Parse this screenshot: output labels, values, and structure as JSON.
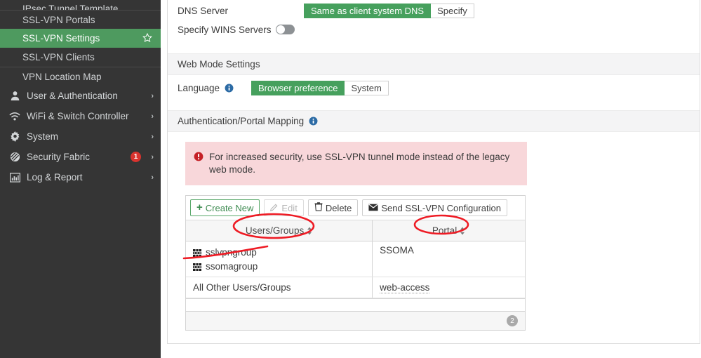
{
  "sidebar": {
    "items": [
      {
        "label": "IPsec Tunnel Template",
        "type": "sub",
        "partial": true
      },
      {
        "label": "SSL-VPN Portals",
        "type": "sub"
      },
      {
        "label": "SSL-VPN Settings",
        "type": "sub",
        "active": true,
        "star": "★"
      },
      {
        "label": "SSL-VPN Clients",
        "type": "sub"
      },
      {
        "label": "VPN Location Map",
        "type": "sub"
      },
      {
        "label": "User & Authentication",
        "type": "top",
        "icon": "user-icon",
        "chevron": "›"
      },
      {
        "label": "WiFi & Switch Controller",
        "type": "top",
        "icon": "wifi-icon",
        "chevron": "›"
      },
      {
        "label": "System",
        "type": "top",
        "icon": "gear-icon",
        "chevron": "›"
      },
      {
        "label": "Security Fabric",
        "type": "top",
        "icon": "fabric-icon",
        "chevron": "›",
        "badge": "1"
      },
      {
        "label": "Log & Report",
        "type": "top",
        "icon": "chart-icon",
        "chevron": "›"
      }
    ]
  },
  "main": {
    "dns_server": {
      "label": "DNS Server",
      "options": [
        "Same as client system DNS",
        "Specify"
      ],
      "selected": "Same as client system DNS"
    },
    "wins": {
      "label": "Specify WINS Servers",
      "toggle_state": "off"
    },
    "web_mode_header": "Web Mode Settings",
    "language": {
      "label": "Language",
      "info_icon": "info-icon",
      "options": [
        "Browser preference",
        "System"
      ],
      "selected": "Browser preference"
    },
    "auth_portal_header": "Authentication/Portal Mapping",
    "auth_portal_info_icon": "info-icon",
    "warning": {
      "icon": "error-icon",
      "text": "For increased security, use SSL-VPN tunnel mode instead of the legacy web mode."
    },
    "toolbar": {
      "create_new": "Create New",
      "create_new_icon": "plus-icon",
      "edit": "Edit",
      "edit_icon": "pencil-icon",
      "delete": "Delete",
      "delete_icon": "trash-icon",
      "send_config": "Send SSL-VPN Configuration",
      "send_config_icon": "envelope-icon"
    },
    "table": {
      "columns": [
        "Users/Groups",
        "Portal"
      ],
      "rows": [
        {
          "users": [
            "sslvpngroup",
            "ssomagroup"
          ],
          "users_icon": "group-grid-icon",
          "portal": "SSOMA",
          "portal_link": false
        },
        {
          "users": [
            "All Other Users/Groups"
          ],
          "users_icon": null,
          "portal": "web-access",
          "portal_link": true
        }
      ],
      "count_badge": "2"
    }
  },
  "colors": {
    "accent_green": "#46a05d",
    "sidebar_bg": "#353535",
    "sidebar_active": "#4e9a5f",
    "warning_bg": "#f8d7da",
    "badge_red": "#d9332e",
    "annotation_red": "#ee1b24"
  }
}
